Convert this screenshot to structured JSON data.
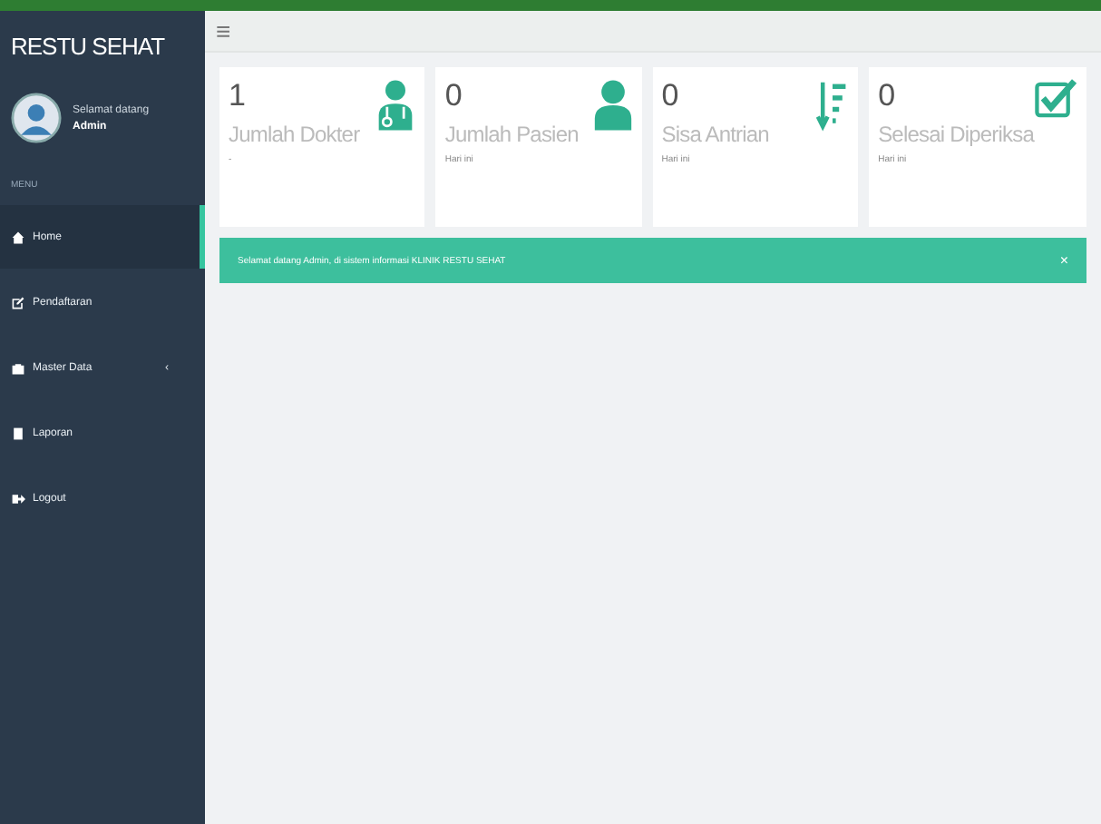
{
  "brand": "RESTU SEHAT",
  "user": {
    "greeting": "Selamat datang",
    "name": "Admin"
  },
  "menu_header": "MENU",
  "menu": [
    {
      "label": "Home",
      "kind": "home",
      "selected": true
    },
    {
      "label": "Pendaftaran",
      "kind": "edit",
      "selected": false
    },
    {
      "label": "Master Data",
      "kind": "briefcase",
      "selected": false,
      "arrow": "‹"
    },
    {
      "label": "Laporan",
      "kind": "book",
      "selected": false
    },
    {
      "label": "Logout",
      "kind": "signout",
      "selected": false
    }
  ],
  "menu_toggle": "≡",
  "cards": [
    {
      "value": "1",
      "label": "Jumlah Dokter",
      "note": "-",
      "kind": "doctor"
    },
    {
      "value": "0",
      "label": "Jumlah Pasien",
      "note": "Hari ini",
      "kind": "user"
    },
    {
      "value": "0",
      "label": "Sisa Antrian",
      "note": "Hari ini",
      "kind": "sort"
    },
    {
      "value": "0",
      "label": "Selesai Diperiksa",
      "note": "Hari ini",
      "kind": "check"
    }
  ],
  "alert": {
    "text": "Selamat datang Admin, di sistem informasi KLINIK RESTU SEHAT",
    "close": "×"
  }
}
